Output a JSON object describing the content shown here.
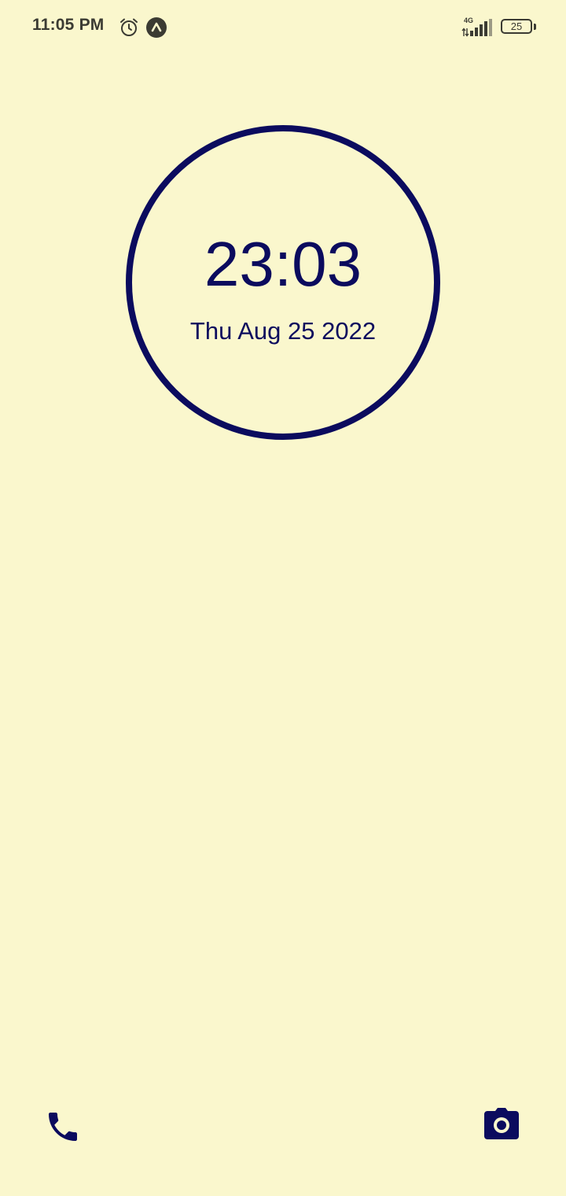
{
  "status_bar": {
    "time": "11:05 PM",
    "alarm_icon": "alarm-clock-icon",
    "app_icon": "caret-up-circle-icon",
    "network_type": "4G",
    "signal_icon": "signal-bars-icon",
    "battery_level": "25",
    "text_color": "#3b3b33"
  },
  "clock": {
    "time": "23:03",
    "date": "Thu Aug 25 2022",
    "accent_color": "#0B0B5E"
  },
  "shortcuts": {
    "phone_icon": "phone-icon",
    "camera_icon": "camera-icon"
  },
  "theme": {
    "background": "#FAF7CD"
  }
}
